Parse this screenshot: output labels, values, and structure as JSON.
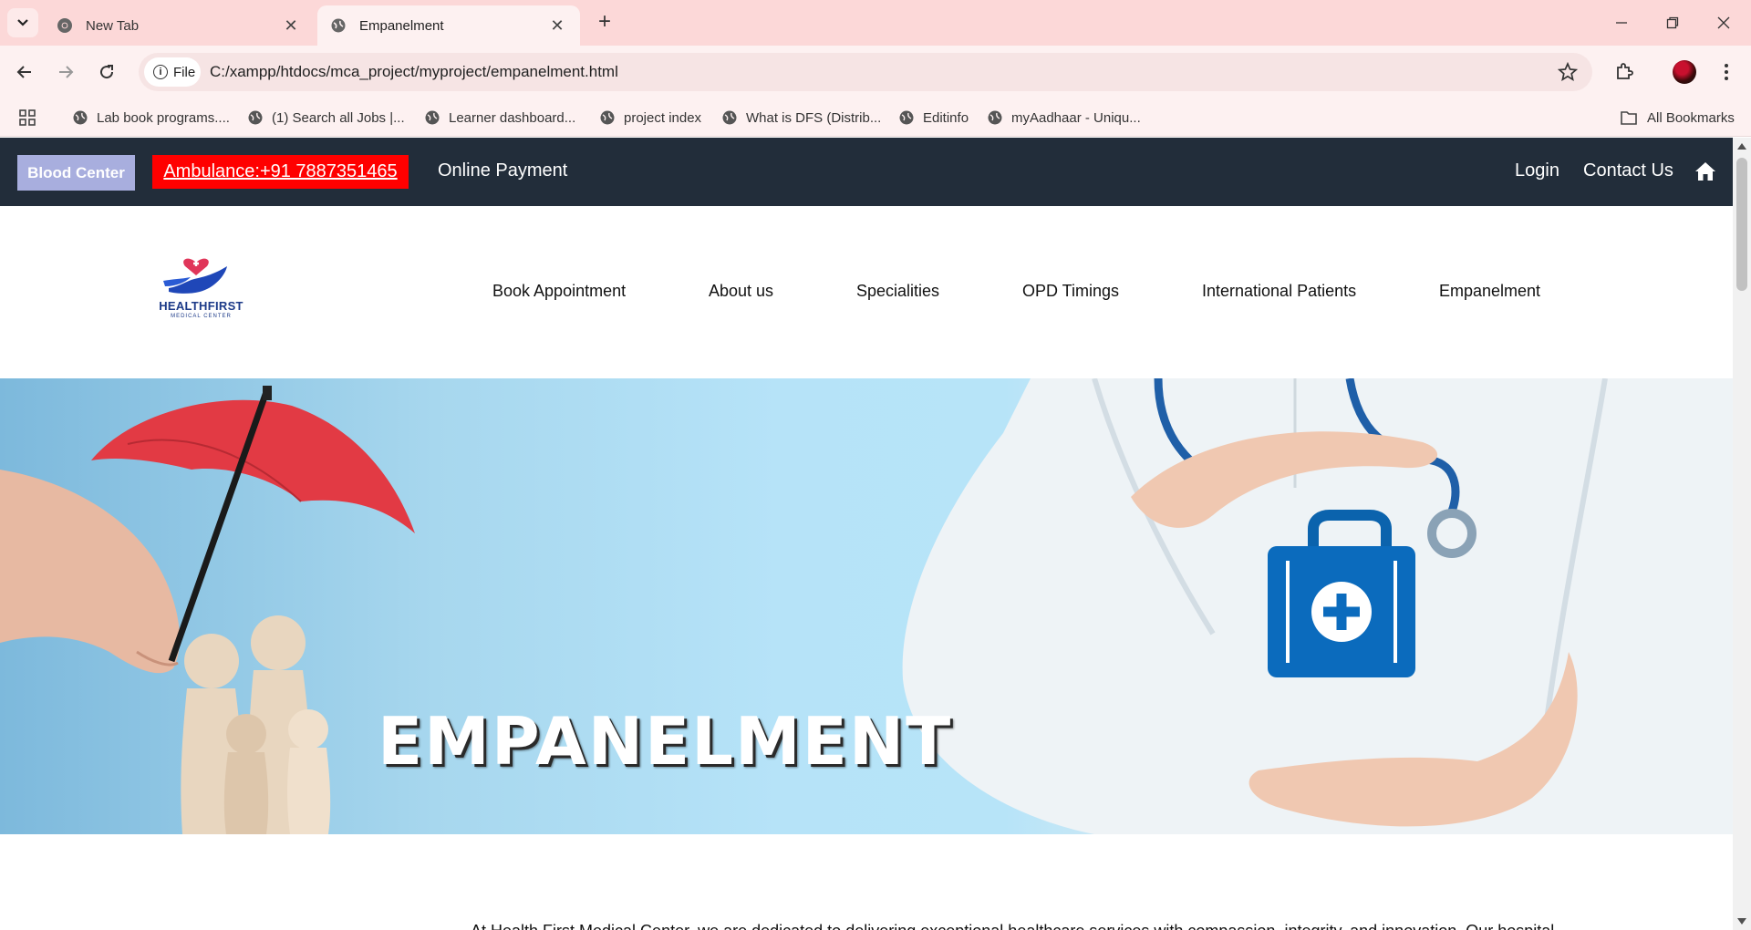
{
  "browser": {
    "tabs": [
      {
        "title": "New Tab",
        "active": false
      },
      {
        "title": "Empanelment",
        "active": true
      }
    ],
    "address": {
      "chip_label": "File",
      "url": "C:/xampp/htdocs/mca_project/myproject/empanelment.html"
    },
    "bookmarks": [
      "Lab book programs....",
      "(1) Search all Jobs |...",
      "Learner dashboard...",
      "project index",
      "What is DFS (Distrib...",
      "Editinfo",
      "myAadhaar - Uniqu..."
    ],
    "all_bookmarks_label": "All Bookmarks"
  },
  "page": {
    "topbar": {
      "blood_center": "Blood Center",
      "ambulance": "Ambulance:+91 7887351465",
      "online_payment": "Online Payment",
      "login": "Login",
      "contact": "Contact Us"
    },
    "logo": {
      "name": "HEALTHFIRST",
      "subtitle": "MEDICAL CENTER"
    },
    "nav": [
      "Book Appointment",
      "About us",
      "Specialities",
      "OPD Timings",
      "International Patients",
      "Empanelment"
    ],
    "hero": {
      "title": "EMPANELMENT"
    },
    "intro_text": "At Health First Medical Center, we are dedicated to delivering exceptional healthcare services with compassion, integrity, and innovation. Our hospital..."
  },
  "colors": {
    "tab_strip": "#fcd8d8",
    "topbar_bg": "#222d3a",
    "blood_center_bg": "#a8aede",
    "ambulance_bg": "#ff0000",
    "logo_blue": "#1c3a88",
    "logo_heart": "#e0365a"
  }
}
